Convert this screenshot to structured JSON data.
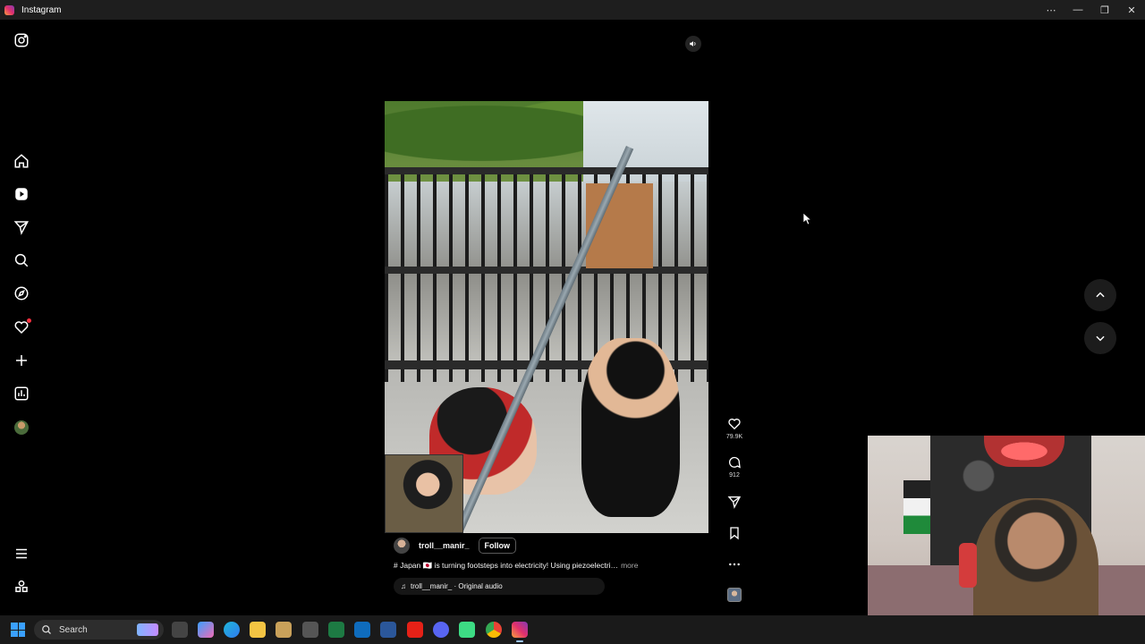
{
  "window": {
    "title": "Instagram",
    "controls": [
      "more-icon",
      "minimize-icon",
      "restore-icon",
      "close-icon"
    ]
  },
  "sidebar": {
    "top": "instagram-logo-icon",
    "items": [
      {
        "name": "home-icon"
      },
      {
        "name": "reels-icon"
      },
      {
        "name": "messages-icon"
      },
      {
        "name": "search-icon"
      },
      {
        "name": "explore-icon"
      },
      {
        "name": "notifications-icon"
      },
      {
        "name": "create-icon"
      },
      {
        "name": "dashboard-icon"
      },
      {
        "name": "profile-avatar"
      }
    ],
    "bottom": [
      "menu-icon",
      "threads-icon"
    ]
  },
  "reel": {
    "username": "troll__manir_",
    "follow_label": "Follow",
    "caption": "# Japan 🇯🇵 is turning footsteps into electricity! Using piezoelectri…",
    "more_label": "more",
    "audio": "troll__manir_ · Original audio"
  },
  "actions": {
    "likes": "79.9K",
    "comments": "912"
  },
  "taskbar": {
    "search_placeholder": "Search"
  },
  "colors": {
    "background": "#000000",
    "notification_dot": "#ff3040",
    "taskbar": "#1a1a1a"
  }
}
